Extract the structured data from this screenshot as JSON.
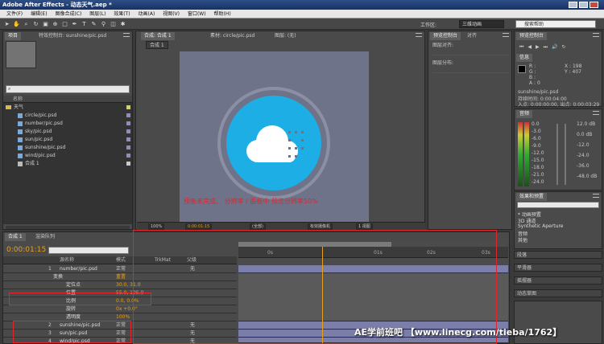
{
  "app": {
    "title": "Adobe After Effects - 动态天气.aep *"
  },
  "menu": [
    "文件(F)",
    "编辑(E)",
    "图像合成(C)",
    "图层(L)",
    "效果(T)",
    "动画(A)",
    "视图(V)",
    "窗口(W)",
    "帮助(H)"
  ],
  "toolbar": {
    "workspace_label": "工作区:",
    "workspace_value": "三维动画",
    "help_placeholder": "搜索帮助"
  },
  "project": {
    "tabs": [
      "项目",
      "特效控制台: sunshine/pic.psd"
    ],
    "search_placeholder": "",
    "column_name": "名称",
    "folder": "天气",
    "items": [
      {
        "name": "circle/pic.psd"
      },
      {
        "name": "number/pic.psd"
      },
      {
        "name": "sky/pic.psd"
      },
      {
        "name": "sun/pic.psd"
      },
      {
        "name": "sunshine/pic.psd"
      },
      {
        "name": "wind/pic.psd"
      },
      {
        "name": "合成 1"
      }
    ]
  },
  "composition": {
    "tabs": [
      "合成: 合成 1",
      "素材: circle/pic.psd",
      "图层: (无)"
    ],
    "subtab": "合成 1",
    "warning": "预备未完成。 分辨率 / 面板中 预览分辨率50%",
    "footer": {
      "zoom": "100%",
      "timecode": "0:00:01:15",
      "resolution": "(全部)",
      "camera": "有效摄像机",
      "views": "1 视图"
    },
    "colors": {
      "circle": "#1daee5",
      "ring": "#8b8fa3",
      "cloud": "#ffffff",
      "canvas": "#6e7389"
    }
  },
  "right_top": {
    "tabs": [
      "预览控制台",
      "对齐"
    ],
    "header": "图层对齐:",
    "distribute": "图层分布:"
  },
  "info": {
    "tab": "信息",
    "r": "R :",
    "g": "G :",
    "b": "B :",
    "a": "A : 0",
    "x": "X : 198",
    "y": "Y : 407",
    "line1": "sunshine/pic.psd",
    "line2": "持续时间: 0:00:04:00",
    "line3": "入点: 0:00:00:00, 出点: 0:00:03:29"
  },
  "audio": {
    "tab": "音频",
    "left_scale": [
      "0.0",
      "-3.0",
      "-6.0",
      "-9.0",
      "-12.0",
      "-15.0",
      "-18.0",
      "-21.0",
      "-24.0"
    ],
    "right_scale": [
      "12.0 dB",
      "0.0 dB",
      "-12.0",
      "-24.0",
      "-36.0",
      "-48.0 dB"
    ]
  },
  "effects": {
    "tab": "效果和预置",
    "items": [
      "* 动画预置",
      "3D 通道",
      "Synthetic Aperture",
      "音频",
      "其他"
    ]
  },
  "side_panels": [
    "段落",
    "平滑器",
    "摇摆器",
    "动态草图"
  ],
  "timeline": {
    "tabs": [
      "合成 1",
      "渲染队列"
    ],
    "current_time": "0:00:01:15",
    "columns": {
      "source": "源名称",
      "mode": "模式",
      "trkmat": "TrkMat",
      "parent": "父级"
    },
    "layers": [
      {
        "index": "1",
        "name": "number/pic.psd",
        "mode": "正常"
      },
      {
        "index": "",
        "name": "变换",
        "mode": "重置"
      },
      {
        "index": "",
        "name": "定位点",
        "mode": "30.0, 31.0"
      },
      {
        "index": "",
        "name": "位置",
        "mode": "55.0, 105.0"
      },
      {
        "index": "",
        "name": "比例",
        "mode": "0.0, 0.0%"
      },
      {
        "index": "",
        "name": "旋转",
        "mode": "0x +0.0°"
      },
      {
        "index": "",
        "name": "透明度",
        "mode": "100%"
      },
      {
        "index": "2",
        "name": "sunshine/pic.psd",
        "mode": "正常"
      },
      {
        "index": "3",
        "name": "sun/pic.psd",
        "mode": "正常"
      },
      {
        "index": "4",
        "name": "wind/pic.psd",
        "mode": "正常"
      }
    ],
    "ruler_labels": [
      "0s",
      "01s",
      "02s",
      "03s"
    ],
    "parent_value": "无"
  },
  "watermark": "AE学前班吧 【www.linecg.com/tieba/1762】"
}
